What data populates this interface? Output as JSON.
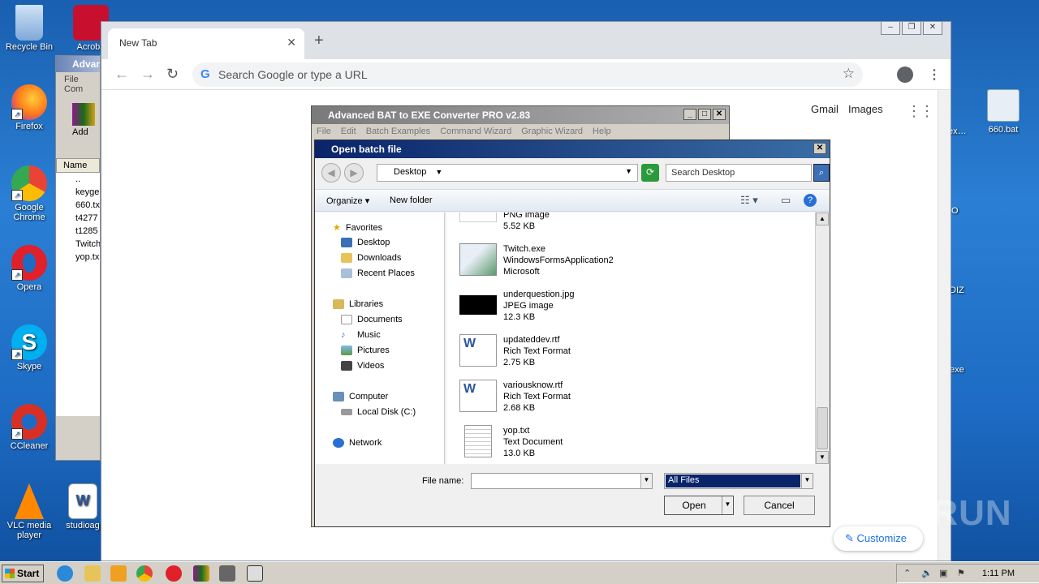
{
  "desktop": {
    "icons": [
      {
        "label": "Recycle Bin",
        "color": "#7fa8d8"
      },
      {
        "label": "Firefox",
        "color": "#ff7a1a"
      },
      {
        "label": "Google Chrome",
        "color": "#34a853"
      },
      {
        "label": "Opera",
        "color": "#e0202a"
      },
      {
        "label": "Skype",
        "color": "#00aff0"
      },
      {
        "label": "CCleaner",
        "color": "#d93025"
      },
      {
        "label": "VLC media player",
        "color": "#ff8800"
      }
    ],
    "partial_icons": [
      "Acroba",
      "studioag"
    ],
    "right_icons": [
      "660.bat",
      "ex…",
      "DIZ",
      "exe",
      "O"
    ]
  },
  "chrome": {
    "tab_title": "New Tab",
    "omnibox_placeholder": "Search Google or type a URL",
    "links": {
      "gmail": "Gmail",
      "images": "Images"
    },
    "customize": "Customize"
  },
  "winrar": {
    "title": "Advan",
    "menu": [
      "File",
      "Com"
    ],
    "add_label": "Add",
    "column": "Name",
    "rows": [
      "..",
      "keyge",
      "660.tx",
      "t4277",
      "t1285",
      "Twitch",
      "yop.tx"
    ]
  },
  "batconverter": {
    "title": "Advanced BAT to EXE Converter PRO v2.83",
    "menu": [
      "File",
      "Edit",
      "Batch Examples",
      "Command Wizard",
      "Graphic Wizard",
      "Help"
    ]
  },
  "dialog": {
    "title": "Open batch file",
    "location": "Desktop",
    "search_placeholder": "Search Desktop",
    "organize": "Organize",
    "new_folder": "New folder",
    "nav": {
      "favorites": "Favorites",
      "favorite_items": [
        "Desktop",
        "Downloads",
        "Recent Places"
      ],
      "libraries": "Libraries",
      "library_items": [
        "Documents",
        "Music",
        "Pictures",
        "Videos"
      ],
      "computer": "Computer",
      "computer_items": [
        "Local Disk (C:)"
      ],
      "network": "Network"
    },
    "files": [
      {
        "name": "",
        "type": "PNG image",
        "size": "5.52 KB",
        "icon": "png"
      },
      {
        "name": "Twitch.exe",
        "type": "WindowsFormsApplication2",
        "size": "Microsoft",
        "icon": "exe"
      },
      {
        "name": "underquestion.jpg",
        "type": "JPEG image",
        "size": "12.3 KB",
        "icon": "jpg"
      },
      {
        "name": "updateddev.rtf",
        "type": "Rich Text Format",
        "size": "2.75 KB",
        "icon": "rtf"
      },
      {
        "name": "variousknow.rtf",
        "type": "Rich Text Format",
        "size": "2.68 KB",
        "icon": "rtf"
      },
      {
        "name": "yop.txt",
        "type": "Text Document",
        "size": "13.0 KB",
        "icon": "txt"
      }
    ],
    "file_name_label": "File name:",
    "file_name_value": "",
    "filter": "All Files",
    "open": "Open",
    "cancel": "Cancel"
  },
  "taskbar": {
    "start": "Start",
    "clock": "1:11 PM"
  },
  "watermark": "ANY RUN"
}
